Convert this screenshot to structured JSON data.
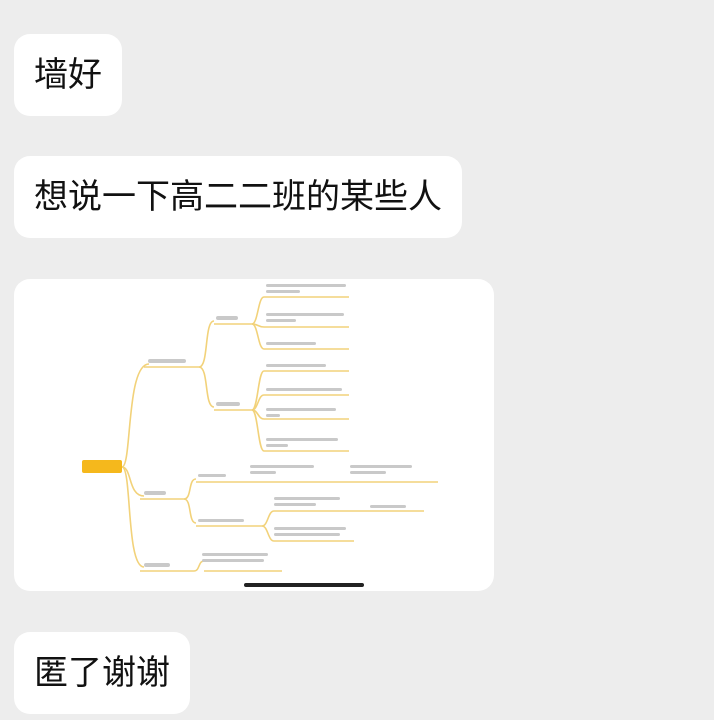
{
  "messages": [
    {
      "id": "msg1",
      "text": "墙好"
    },
    {
      "id": "msg2",
      "text": "想说一下高二二班的某些人"
    },
    {
      "id": "msg3",
      "type": "image",
      "content": "mind-map"
    },
    {
      "id": "msg4",
      "text": "匿了谢谢"
    }
  ],
  "mindmap_node_color": "#f5b81c",
  "mindmap_line_color": "#f2d27a"
}
